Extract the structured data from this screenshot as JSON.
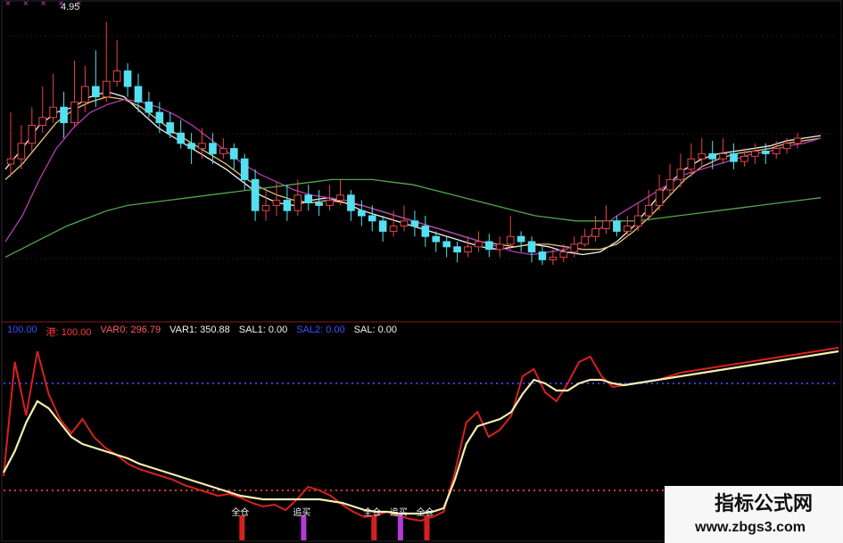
{
  "chart_data": [
    {
      "type": "candlestick",
      "price_label": "4.95",
      "top_markers": [
        "×",
        "×",
        "×",
        "×",
        "×"
      ],
      "candles": [
        [
          40,
          42,
          60,
          35
        ],
        [
          42,
          48,
          55,
          38
        ],
        [
          48,
          55,
          62,
          45
        ],
        [
          55,
          58,
          70,
          52
        ],
        [
          58,
          62,
          75,
          56
        ],
        [
          62,
          56,
          68,
          50
        ],
        [
          56,
          64,
          80,
          54
        ],
        [
          64,
          70,
          78,
          60
        ],
        [
          70,
          66,
          84,
          62
        ],
        [
          66,
          72,
          95,
          64
        ],
        [
          72,
          76,
          88,
          70
        ],
        [
          76,
          70,
          79,
          66
        ],
        [
          70,
          64,
          75,
          60
        ],
        [
          64,
          60,
          68,
          58
        ],
        [
          60,
          56,
          64,
          52
        ],
        [
          56,
          52,
          60,
          50
        ],
        [
          52,
          48,
          57,
          46
        ],
        [
          48,
          46,
          52,
          40
        ],
        [
          46,
          48,
          54,
          42
        ],
        [
          48,
          44,
          52,
          40
        ],
        [
          44,
          46,
          50,
          42
        ],
        [
          46,
          42,
          48,
          38
        ],
        [
          42,
          34,
          44,
          30
        ],
        [
          34,
          22,
          38,
          18
        ],
        [
          22,
          24,
          30,
          18
        ],
        [
          24,
          26,
          33,
          20
        ],
        [
          26,
          22,
          32,
          18
        ],
        [
          22,
          28,
          34,
          20
        ],
        [
          28,
          25,
          32,
          22
        ],
        [
          25,
          24,
          30,
          20
        ],
        [
          24,
          26,
          32,
          22
        ],
        [
          26,
          28,
          34,
          24
        ],
        [
          28,
          22,
          30,
          18
        ],
        [
          22,
          20,
          26,
          16
        ],
        [
          20,
          18,
          24,
          14
        ],
        [
          18,
          14,
          20,
          10
        ],
        [
          14,
          16,
          22,
          12
        ],
        [
          16,
          18,
          24,
          14
        ],
        [
          18,
          16,
          22,
          12
        ],
        [
          16,
          12,
          20,
          8
        ],
        [
          12,
          10,
          14,
          6
        ],
        [
          10,
          8,
          12,
          4
        ],
        [
          8,
          6,
          10,
          2
        ],
        [
          6,
          8,
          12,
          4
        ],
        [
          8,
          10,
          14,
          6
        ],
        [
          10,
          7,
          13,
          4
        ],
        [
          7,
          9,
          12,
          4
        ],
        [
          9,
          12,
          20,
          7
        ],
        [
          12,
          10,
          14,
          6
        ],
        [
          10,
          6,
          12,
          2
        ],
        [
          6,
          3,
          8,
          1
        ],
        [
          3,
          4,
          7,
          1
        ],
        [
          4,
          6,
          9,
          2
        ],
        [
          6,
          9,
          12,
          4
        ],
        [
          9,
          12,
          15,
          8
        ],
        [
          12,
          15,
          20,
          10
        ],
        [
          15,
          18,
          24,
          13
        ],
        [
          18,
          14,
          20,
          12
        ],
        [
          14,
          16,
          20,
          12
        ],
        [
          16,
          20,
          25,
          14
        ],
        [
          20,
          24,
          30,
          18
        ],
        [
          24,
          30,
          36,
          22
        ],
        [
          30,
          34,
          40,
          28
        ],
        [
          34,
          38,
          44,
          31
        ],
        [
          38,
          42,
          48,
          35
        ],
        [
          42,
          44,
          50,
          39
        ],
        [
          44,
          42,
          49,
          38
        ],
        [
          42,
          44,
          50,
          40
        ],
        [
          44,
          41,
          48,
          38
        ],
        [
          41,
          43,
          46,
          39
        ],
        [
          43,
          45,
          48,
          40
        ],
        [
          45,
          44,
          48,
          40
        ],
        [
          44,
          46,
          49,
          42
        ],
        [
          46,
          48,
          50,
          44
        ],
        [
          48,
          50,
          52,
          46
        ]
      ],
      "ma_series": [
        {
          "color": "#f2f2f2",
          "values": [
            38,
            46,
            55,
            60,
            62,
            66,
            68,
            66,
            60,
            54,
            50,
            46,
            42,
            38,
            33,
            28,
            25,
            24,
            26,
            27,
            25,
            22,
            20,
            18,
            16,
            14,
            12,
            10,
            8,
            7,
            8,
            9,
            8,
            6,
            5,
            6,
            10,
            16,
            24,
            32,
            38,
            42,
            44,
            45,
            46,
            47,
            49,
            50,
            51
          ]
        },
        {
          "color": "#e2c67a",
          "values": [
            34,
            40,
            48,
            56,
            61,
            64,
            66,
            65,
            62,
            57,
            52,
            48,
            44,
            40,
            35,
            31,
            28,
            26,
            25,
            26,
            25,
            24,
            22,
            20,
            18,
            16,
            14,
            12,
            10,
            9,
            8,
            9,
            9,
            8,
            7,
            7,
            9,
            14,
            20,
            27,
            34,
            39,
            42,
            44,
            45,
            46,
            48,
            49,
            50
          ]
        },
        {
          "color": "#b43fb3",
          "values": [
            10,
            20,
            34,
            46,
            54,
            60,
            63,
            65,
            64,
            62,
            59,
            55,
            50,
            45,
            40,
            36,
            33,
            30,
            28,
            27,
            26,
            24,
            22,
            20,
            18,
            16,
            14,
            12,
            10,
            8,
            6,
            5,
            6,
            7,
            10,
            15,
            20,
            24,
            28,
            32,
            36,
            38,
            40,
            42,
            44,
            45,
            47,
            48,
            50
          ]
        },
        {
          "color": "#52a84a",
          "values": [
            4,
            8,
            12,
            16,
            19,
            22,
            24,
            25,
            26,
            27,
            28,
            29,
            30,
            31,
            32,
            33,
            34,
            34,
            34,
            33,
            32,
            30,
            28,
            26,
            24,
            22,
            20,
            19,
            18,
            18,
            18,
            18,
            19,
            20,
            21,
            22,
            23,
            24,
            25,
            26,
            27
          ]
        }
      ]
    },
    {
      "type": "line",
      "legend": [
        {
          "text": "100.00",
          "color": "#3b4fff"
        },
        {
          "text": "港: 100.00",
          "color": "#ff3b3b"
        },
        {
          "text": "VAR0: 296.79",
          "color": "#ff5a5a"
        },
        {
          "text": "VAR1: 350.88",
          "color": "#f2f2f2"
        },
        {
          "text": "SAL1: 0.00",
          "color": "#f2f2f2"
        },
        {
          "text": "SAL2: 0.00",
          "color": "#4050ff"
        },
        {
          "text": "SAL: 0.00",
          "color": "#f2f2f2"
        }
      ],
      "ylim": [
        0,
        100
      ],
      "ref_lines": [
        {
          "value": 80,
          "color": "#3441ff"
        },
        {
          "value": 20,
          "color": "#ff3030"
        }
      ],
      "series": [
        {
          "color": "#d92020",
          "values": [
            28,
            92,
            62,
            98,
            74,
            60,
            52,
            60,
            50,
            44,
            40,
            35,
            32,
            30,
            28,
            26,
            23,
            21,
            19,
            17,
            18,
            16,
            13,
            11,
            12,
            9,
            15,
            22,
            20,
            17,
            12,
            8,
            5,
            6,
            8,
            6,
            4,
            3,
            5,
            8,
            30,
            58,
            64,
            50,
            54,
            62,
            84,
            88,
            75,
            70,
            80,
            92,
            95,
            84,
            78,
            79,
            80,
            81,
            82,
            84,
            86,
            87,
            88,
            89,
            90,
            91,
            92,
            93,
            94,
            95,
            96,
            97,
            98,
            99,
            100
          ]
        },
        {
          "color": "#f3efb0",
          "values": [
            30,
            42,
            58,
            70,
            66,
            58,
            50,
            46,
            44,
            42,
            40,
            38,
            35,
            33,
            31,
            29,
            27,
            25,
            23,
            21,
            19,
            17,
            16,
            15,
            15,
            15,
            15,
            15,
            15,
            14,
            13,
            11,
            9,
            8,
            8,
            7,
            7,
            7,
            8,
            10,
            26,
            46,
            56,
            58,
            60,
            64,
            74,
            82,
            80,
            76,
            76,
            80,
            82,
            82,
            80,
            79,
            80,
            81,
            82,
            83,
            84,
            85,
            86,
            87,
            88,
            89,
            90,
            91,
            92,
            93,
            94,
            95,
            96,
            97,
            98
          ]
        }
      ],
      "markers": [
        {
          "label": "全仓",
          "x_index": 20,
          "kind": "full"
        },
        {
          "label": "追买",
          "x_index": 27,
          "kind": "chase"
        },
        {
          "label": "全仓",
          "x_index": 35,
          "kind": "full"
        },
        {
          "label": "追买",
          "x_index": 38,
          "kind": "chase"
        },
        {
          "label": "全仓",
          "x_index": 41,
          "kind": "full"
        }
      ],
      "buy_bar_colors": {
        "full": "#d62020",
        "chase": "#b43cd6"
      }
    }
  ],
  "watermark": {
    "title": "指标公式网",
    "url": "www.zbgs3.com"
  }
}
